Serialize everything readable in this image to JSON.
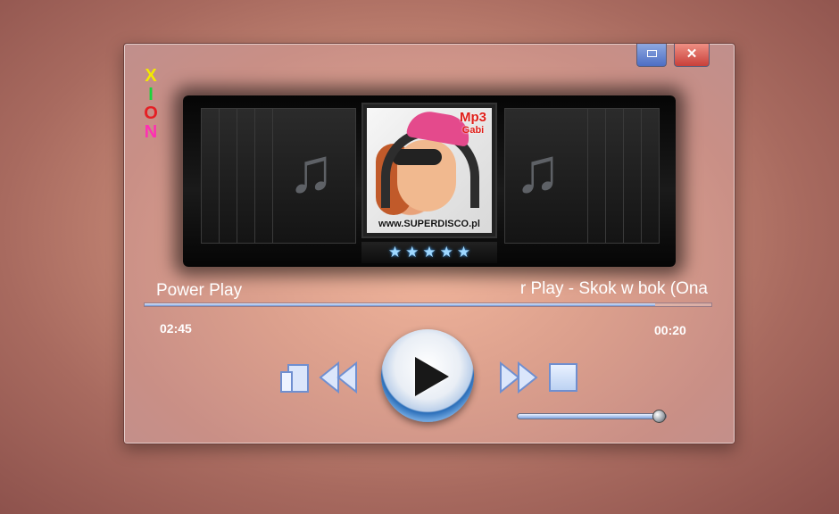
{
  "window": {
    "minimize_icon": "window-restore-icon",
    "close_label": "✕"
  },
  "logo": {
    "letters": [
      "X",
      "I",
      "O",
      "N"
    ],
    "colors": [
      "#f3e900",
      "#1ad43b",
      "#e51f24",
      "#ff2fb3"
    ]
  },
  "album": {
    "badge_main": "Mp3",
    "badge_sub": "Gabi",
    "url_text": "www.SUPERDISCO.pl",
    "rating": 5,
    "rating_max": 5
  },
  "track": {
    "title_left": "Power Play",
    "title_scrolling": "r Play - Skok w bok  (Ona",
    "elapsed": "02:45",
    "remaining": "00:20",
    "progress_fraction": 0.9
  },
  "controls": {
    "playlist_icon": "playlist-icon",
    "prev_icon": "rewind-icon",
    "play_icon": "play-icon",
    "next_icon": "fast-forward-icon",
    "stop_icon": "stop-icon"
  },
  "volume": {
    "level_fraction": 1.0
  },
  "colors": {
    "accent": "#6f93d4",
    "close": "#c8403a"
  }
}
